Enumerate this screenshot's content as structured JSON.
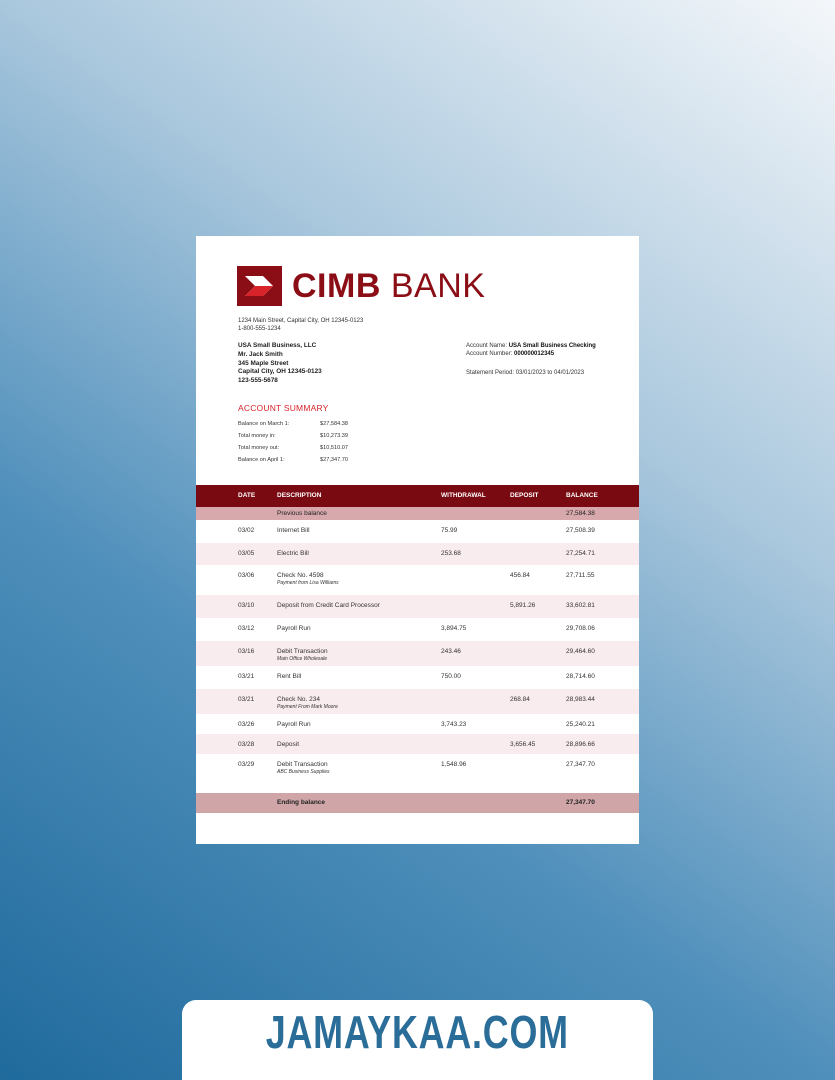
{
  "bank": {
    "name_bold": "CIMB",
    "name_light": "BANK",
    "brand_color": "#8b0e17",
    "accent_color": "#d8232a"
  },
  "bank_address": {
    "line1": "1234 Main Street, Capital City, OH 12345-0123",
    "line2": "1-800-555-1234"
  },
  "customer": {
    "name": "USA Small Business, LLC",
    "contact": "Mr. Jack Smith",
    "street": "345 Maple Street",
    "city": "Capital City, OH 12345-0123",
    "phone": "123-555-5678"
  },
  "account": {
    "name_label": "Account Name:",
    "name_value": "USA Small Business Checking",
    "number_label": "Account Number:",
    "number_value": "000000012345",
    "period": "Statement Period: 03/01/2023 to 04/01/2023"
  },
  "summary": {
    "title": "ACCOUNT SUMMARY",
    "rows": [
      {
        "label": "Balance on March 1:",
        "value": "$27,584.38"
      },
      {
        "label": "Total money in:",
        "value": "$10,273.39"
      },
      {
        "label": "Total money out:",
        "value": "$10,510.07"
      },
      {
        "label": "Balance on April 1:",
        "value": "$27,347.70"
      }
    ]
  },
  "table": {
    "headers": {
      "date": "DATE",
      "description": "DESCRIPTION",
      "withdrawal": "WITHDRAWAL",
      "deposit": "DEPOSIT",
      "balance": "BALANCE"
    },
    "previous": {
      "label": "Previous balance",
      "balance": "27,584.38"
    },
    "rows": [
      {
        "date": "03/02",
        "desc": "Internet Bill",
        "sub": "",
        "wd": "75.99",
        "dep": "",
        "bal": "27,508.39"
      },
      {
        "date": "03/05",
        "desc": "Electric Bill",
        "sub": "",
        "wd": "253.68",
        "dep": "",
        "bal": "27,254.71"
      },
      {
        "date": "03/06",
        "desc": "Check No. 4598",
        "sub": "Payment from Lisa Williams",
        "wd": "",
        "dep": "456.84",
        "bal": "27,711.55"
      },
      {
        "date": "03/10",
        "desc": "Deposit from Credit Card Processor",
        "sub": "",
        "wd": "",
        "dep": "5,891.26",
        "bal": "33,602.81"
      },
      {
        "date": "03/12",
        "desc": "Payroll Run",
        "sub": "",
        "wd": "3,894.75",
        "dep": "",
        "bal": "29,708.06"
      },
      {
        "date": "03/16",
        "desc": "Debit Transaction",
        "sub": "Main Office Wholesale",
        "wd": "243.46",
        "dep": "",
        "bal": "29,464.60"
      },
      {
        "date": "03/21",
        "desc": "Rent Bill",
        "sub": "",
        "wd": "750.00",
        "dep": "",
        "bal": "28,714.60"
      },
      {
        "date": "03/21",
        "desc": "Check No. 234",
        "sub": "Payment From Mark Moore",
        "wd": "",
        "dep": "268.84",
        "bal": "28,983.44"
      },
      {
        "date": "03/26",
        "desc": "Payroll Run",
        "sub": "",
        "wd": "3,743.23",
        "dep": "",
        "bal": "25,240.21"
      },
      {
        "date": "03/28",
        "desc": "Deposit",
        "sub": "",
        "wd": "",
        "dep": "3,656.45",
        "bal": "28,896.66"
      },
      {
        "date": "03/29",
        "desc": "Debit Transaction",
        "sub": "ABC Business Supplies",
        "wd": "1,548.96",
        "dep": "",
        "bal": "27,347.70"
      }
    ],
    "ending": {
      "label": "Ending balance",
      "balance": "27,347.70"
    }
  },
  "banner": {
    "text": "JAMAYKAA.COM"
  }
}
